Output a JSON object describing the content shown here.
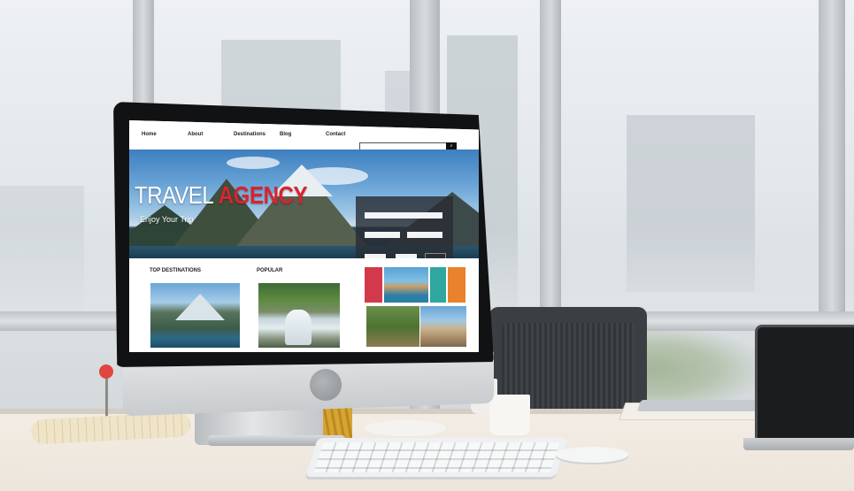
{
  "website": {
    "nav": {
      "items": [
        "Home",
        "About",
        "Destinations",
        "Blog",
        "Contact"
      ],
      "search_button": "⌕"
    },
    "hero": {
      "title_part1": "TRAVEL",
      "title_part2": "AGENCY",
      "subtitle": "Enjoy Your Trip"
    },
    "sections": {
      "top_destinations": "TOP DESTINATIONS",
      "popular": "POPULAR"
    }
  },
  "colors": {
    "accent": "#d7242f",
    "tile_red": "#d23a4b",
    "tile_teal": "#2fa6a0",
    "tile_orange": "#e8822c"
  },
  "icons": [
    "search-icon"
  ]
}
